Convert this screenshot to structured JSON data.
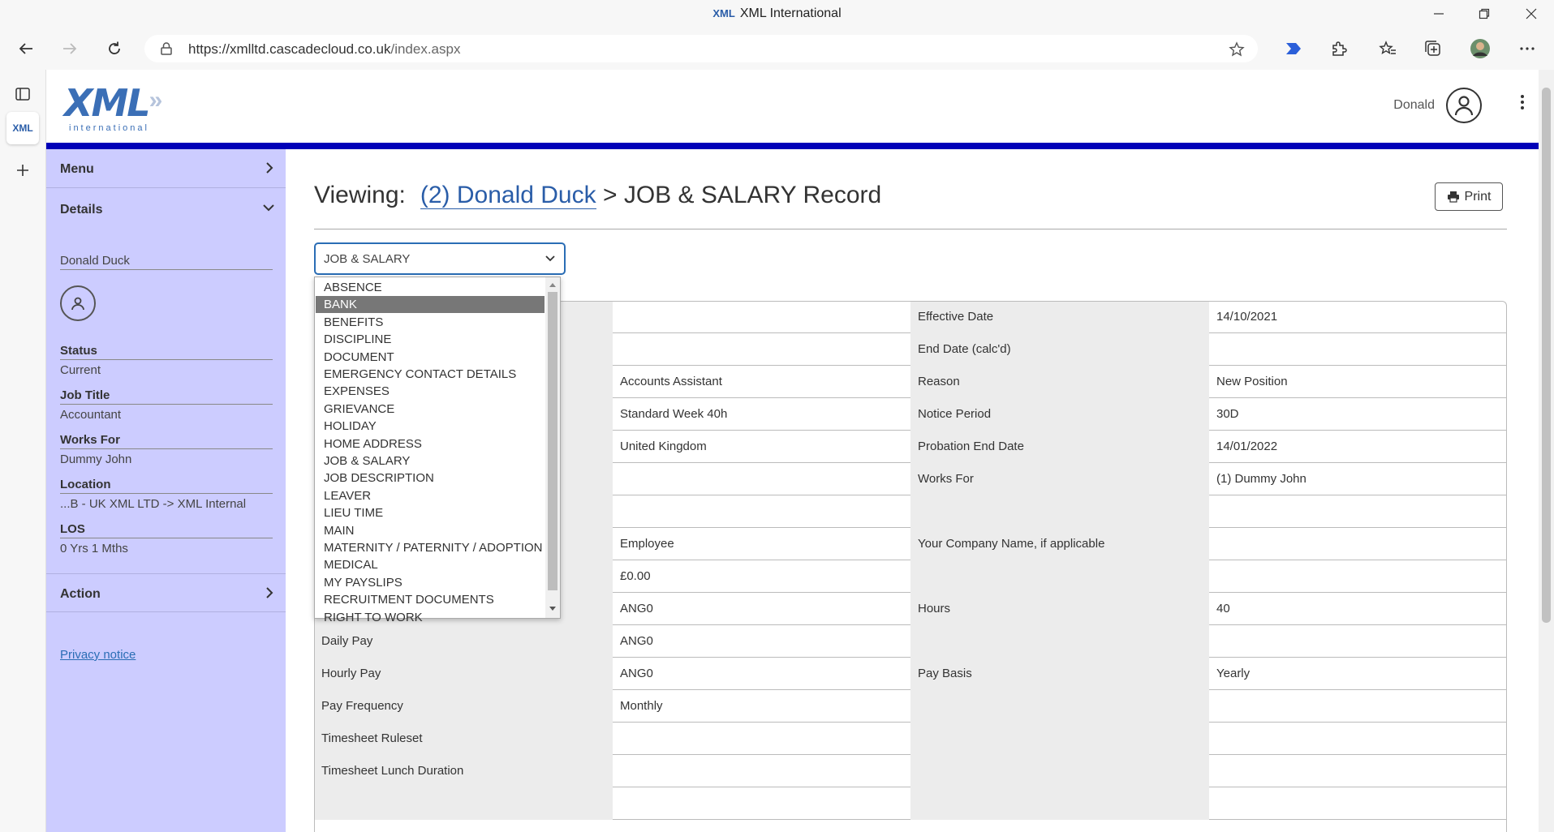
{
  "browser": {
    "window_title": "XML International",
    "title_logo": "XML",
    "url_host": "https://xmlltd.cascadecloud.co.uk",
    "url_path": "/index.aspx",
    "side_tab_label": "XML"
  },
  "header": {
    "brand": "XML",
    "brand_arrows": "»",
    "brand_sub": "international",
    "user_name": "Donald"
  },
  "sidebar": {
    "menu_label": "Menu",
    "details_label": "Details",
    "employee_name": "Donald Duck",
    "fields": [
      {
        "key": "Status",
        "value": "Current"
      },
      {
        "key": "Job Title",
        "value": "Accountant"
      },
      {
        "key": "Works For",
        "value": "Dummy John"
      },
      {
        "key": "Location",
        "value": "...B - UK XML LTD -> XML Internal"
      },
      {
        "key": "LOS",
        "value": "0 Yrs 1 Mths"
      }
    ],
    "action_label": "Action",
    "privacy_label": "Privacy notice"
  },
  "main": {
    "viewing_label": "Viewing:",
    "employee_link": "(2) Donald Duck",
    "record_suffix": "> JOB & SALARY Record",
    "print_label": "Print",
    "record_select_value": "JOB & SALARY",
    "dropdown_options": [
      "ABSENCE",
      "BANK",
      "BENEFITS",
      "DISCIPLINE",
      "DOCUMENT",
      "EMERGENCY CONTACT DETAILS",
      "EXPENSES",
      "GRIEVANCE",
      "HOLIDAY",
      "HOME ADDRESS",
      "JOB & SALARY",
      "JOB DESCRIPTION",
      "LEAVER",
      "LIEU TIME",
      "MAIN",
      "MATERNITY / PATERNITY / ADOPTION",
      "MEDICAL",
      "MY PAYSLIPS",
      "RECRUITMENT DOCUMENTS",
      "RIGHT TO WORK"
    ],
    "dropdown_highlighted": "BANK",
    "rows": [
      [
        "",
        "",
        "Effective Date",
        "14/10/2021"
      ],
      [
        "",
        "",
        "End Date (calc'd)",
        ""
      ],
      [
        "",
        "Accounts Assistant",
        "Reason",
        "New Position"
      ],
      [
        "",
        "Standard Week 40h",
        "Notice Period",
        "30D"
      ],
      [
        "",
        "United Kingdom",
        "Probation End Date",
        "14/01/2022"
      ],
      [
        "",
        "",
        "Works For",
        "(1) Dummy John"
      ],
      [
        "",
        "",
        "",
        ""
      ],
      [
        "",
        "Employee",
        "Your Company Name, if applicable",
        ""
      ],
      [
        "",
        "£0.00",
        "",
        ""
      ],
      [
        "",
        "ANG0",
        "Hours",
        "40"
      ],
      [
        "Daily Pay",
        "ANG0",
        "",
        ""
      ],
      [
        "Hourly Pay",
        "ANG0",
        "Pay Basis",
        "Yearly"
      ],
      [
        "Pay Frequency",
        "Monthly",
        "",
        ""
      ],
      [
        "Timesheet Ruleset",
        "",
        "",
        ""
      ],
      [
        "Timesheet Lunch Duration",
        "",
        "",
        ""
      ],
      [
        "",
        "",
        "",
        ""
      ]
    ]
  }
}
